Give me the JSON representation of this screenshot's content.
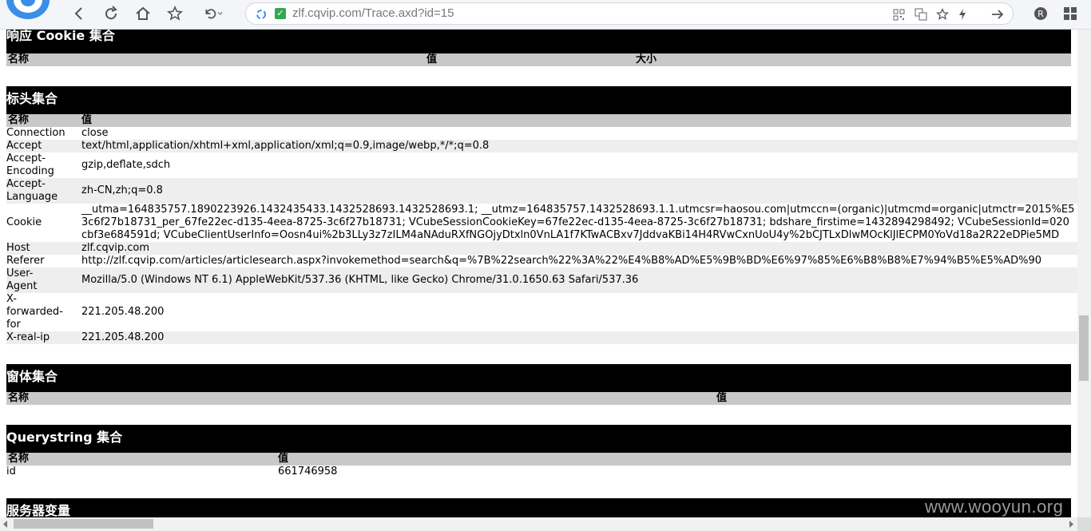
{
  "browser": {
    "url": "zlf.cqvip.com/Trace.axd?id=15"
  },
  "sections": {
    "response_cookies": {
      "title": "响应 Cookie 集合",
      "columns": [
        "名称",
        "值",
        "大小"
      ]
    },
    "headers": {
      "title": "标头集合",
      "columns": [
        "名称",
        "值"
      ],
      "rows": [
        {
          "name": "Connection",
          "value": "close"
        },
        {
          "name": "Accept",
          "value": "text/html,application/xhtml+xml,application/xml;q=0.9,image/webp,*/*;q=0.8"
        },
        {
          "name": "Accept-\nEncoding",
          "value": "gzip,deflate,sdch"
        },
        {
          "name": "Accept-\nLanguage",
          "value": "zh-CN,zh;q=0.8"
        },
        {
          "name": "Cookie",
          "value_lines": [
            "__utma=164835757.1890223926.1432435433.1432528693.1432528693.1; __utmz=164835757.1432528693.1.1.utmcsr=haosou.com|utmccn=(organic)|utmcmd=organic|utmctr=2015%E5",
            "3c6f27b18731_per_67fe22ec-d135-4eea-8725-3c6f27b18731; VCubeSessionCookieKey=67fe22ec-d135-4eea-8725-3c6f27b18731; bdshare_firstime=1432894298492; VCubeSessionId=020",
            "cbf3e684591d; VCubeClientUserInfo=Oosn4ui%2b3LLy3z7zILM4aNAduRXfNGOjyDtxln0VnLA1f7KTwACBxv7JddvaKBi14H4RVwCxnUoU4y%2bCJTLxDlwMOcKlJlECPM0YoVd18a2R22eDPie5MD"
          ]
        },
        {
          "name": "Host",
          "value": "zlf.cqvip.com"
        },
        {
          "name": "Referer",
          "value": "http://zlf.cqvip.com/articles/articlesearch.aspx?invokemethod=search&q=%7B%22search%22%3A%22%E4%B8%AD%E5%9B%BD%E6%97%85%E6%B8%B8%E7%94%B5%E5%AD%90"
        },
        {
          "name": "User-\nAgent",
          "value": "Mozilla/5.0 (Windows NT 6.1) AppleWebKit/537.36 (KHTML, like Gecko) Chrome/31.0.1650.63 Safari/537.36"
        },
        {
          "name": "X-\nforwarded-\nfor",
          "value": "221.205.48.200"
        },
        {
          "name": "X-real-ip",
          "value": "221.205.48.200"
        }
      ]
    },
    "form": {
      "title": "窗体集合",
      "columns": [
        "名称",
        "值"
      ]
    },
    "querystring": {
      "title": "Querystring 集合",
      "columns": [
        "名称",
        "值"
      ],
      "rows": [
        {
          "name": "id",
          "value": "661746958"
        }
      ]
    },
    "server_vars": {
      "title": "服务器变量"
    }
  },
  "watermark": "www.wooyun.org",
  "icons": {
    "back": "back-arrow-icon",
    "refresh": "refresh-icon",
    "home": "home-icon",
    "favorite": "star-icon",
    "undo": "undo-icon",
    "qr": "qr-code-icon",
    "translate": "translate-icon",
    "bolt": "lightning-icon",
    "forward": "forward-arrow-icon",
    "extension": "extension-icon",
    "apps": "apps-grid-icon"
  }
}
